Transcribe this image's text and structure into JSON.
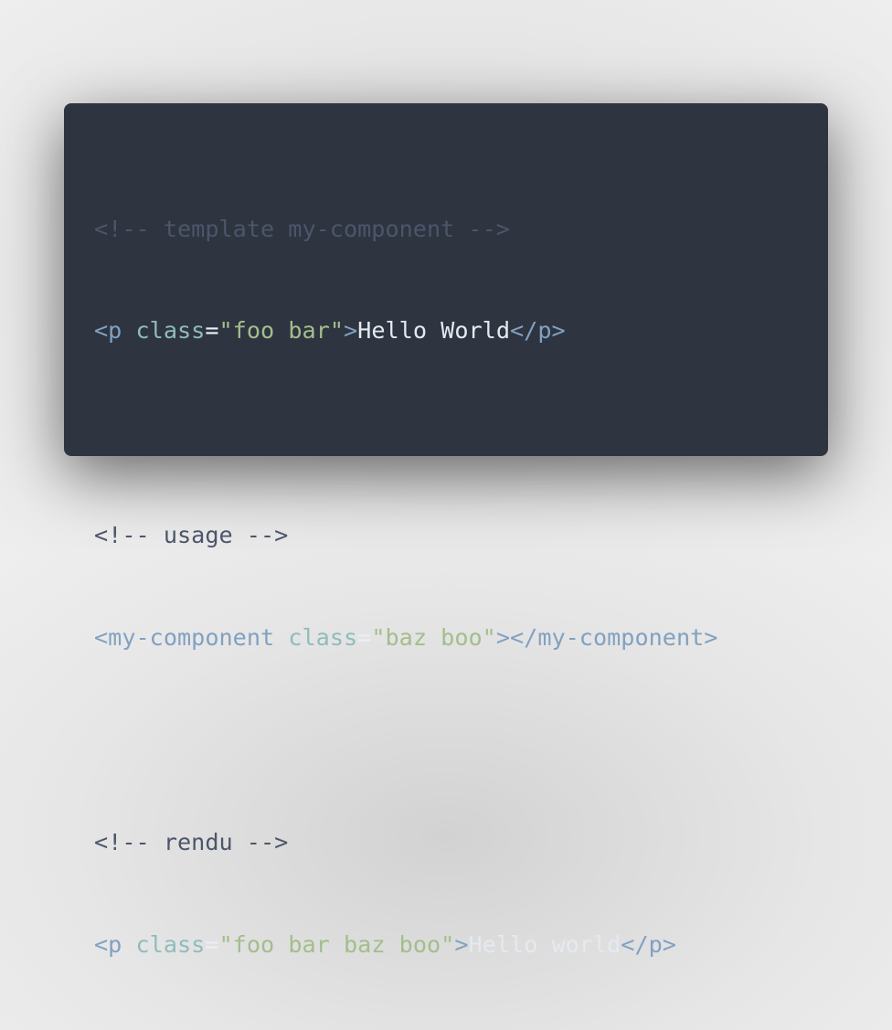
{
  "colors": {
    "background": "#2e3440",
    "comment": "#4c566a",
    "tag": "#81a1c1",
    "attribute": "#8fbcbb",
    "string": "#a3be8c",
    "text": "#e5e9f0"
  },
  "code": {
    "line1": {
      "comment": "<!-- template my-component -->"
    },
    "line2": {
      "open_bracket": "<",
      "tag": "p",
      "attr": "class",
      "eq": "=",
      "value": "\"foo bar\"",
      "close_bracket": ">",
      "text": "Hello World",
      "end_tag": "</p>"
    },
    "line4": {
      "comment": "<!-- usage -->"
    },
    "line5": {
      "open_bracket": "<",
      "tag": "my-component",
      "attr": "class",
      "eq": "=",
      "value": "\"baz boo\"",
      "close_bracket": ">",
      "end_tag": "</my-component>"
    },
    "line7": {
      "comment": "<!-- rendu -->"
    },
    "line8": {
      "open_bracket": "<",
      "tag": "p",
      "attr": "class",
      "eq": "=",
      "value": "\"foo bar baz boo\"",
      "close_bracket": ">",
      "text": "Hello world",
      "end_tag": "</p>"
    }
  }
}
